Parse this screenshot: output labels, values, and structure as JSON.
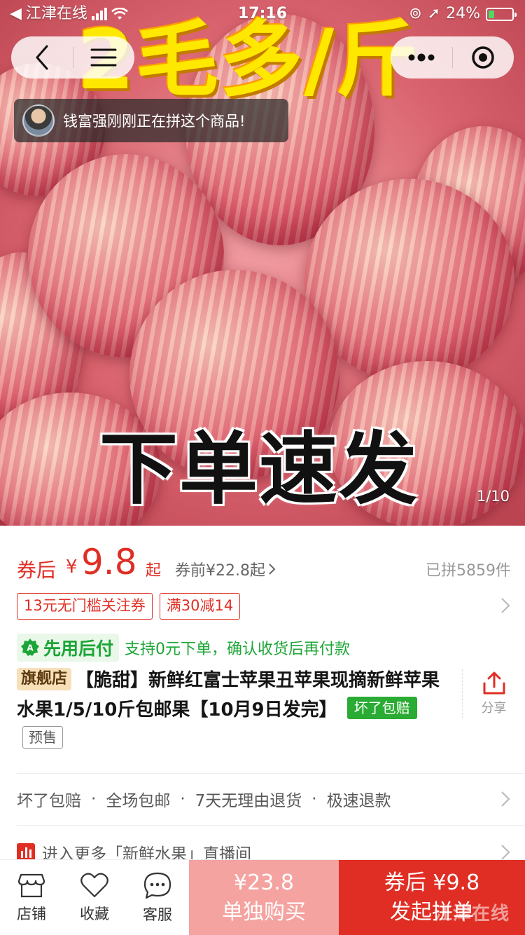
{
  "status_bar": {
    "carrier": "江津在线",
    "time": "17:16",
    "battery": "24%",
    "battery_level": 0.24
  },
  "hero": {
    "headline": "2毛多/斤",
    "caption": "下单速发",
    "counter": "1/10"
  },
  "ticker": {
    "text": "钱富强刚刚正在拼这个商品!"
  },
  "price": {
    "label": "券后",
    "currency": "¥",
    "value": "9.8",
    "suffix": "起",
    "before": "券前¥22.8起",
    "sold": "已拼5859件"
  },
  "coupons": [
    "13元无门槛关注券",
    "满30减14"
  ],
  "pay_later": {
    "badge": "先用后付",
    "desc": "支持0元下单，确认收货后再付款"
  },
  "product": {
    "store_badge": "旗舰店",
    "title": "【脆甜】新鲜红富士苹果丑苹果现摘新鲜苹果水果1/5/10斤包邮果【10月9日发完】",
    "tag_guarantee": "坏了包赔",
    "tag_presale": "预售"
  },
  "share": {
    "label": "分享"
  },
  "services": [
    "坏了包赔",
    "全场包邮",
    "7天无理由退货",
    "极速退款"
  ],
  "services_separator": "·",
  "live": {
    "text": "进入更多「新鲜水果」直播间"
  },
  "bottom_bar": {
    "tabs": [
      {
        "label": "店铺",
        "icon": "store-icon"
      },
      {
        "label": "收藏",
        "icon": "heart-icon"
      },
      {
        "label": "客服",
        "icon": "chat-icon"
      }
    ],
    "solo": {
      "price": "¥23.8",
      "label": "单独购买"
    },
    "group": {
      "price": "券后 ¥9.8",
      "label": "发起拼单"
    },
    "watermark": "江津在线"
  },
  "colors": {
    "accent_red": "#e02e24",
    "pay_green": "#1ba536",
    "solo_pink": "#f4a3a0"
  }
}
